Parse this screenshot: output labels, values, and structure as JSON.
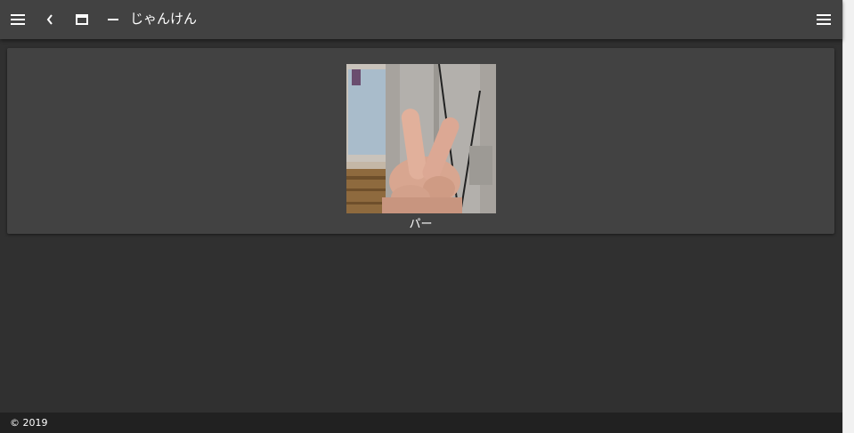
{
  "toolbar": {
    "title": "じゃんけん",
    "buttons": [
      {
        "icon": "menu-icon"
      },
      {
        "icon": "chevron-left-icon"
      },
      {
        "icon": "window-icon"
      },
      {
        "icon": "minimize-icon"
      },
      {
        "icon": "menu-icon"
      }
    ]
  },
  "card": {
    "image_alt": "hand-peace-sign-photo",
    "caption": "パー"
  },
  "footer": {
    "text": "© 2019"
  },
  "colors": {
    "toolbar_bg": "#424242",
    "page_bg": "#303030",
    "card_bg": "#424242",
    "footer_bg": "#212121",
    "text": "#ffffff"
  }
}
